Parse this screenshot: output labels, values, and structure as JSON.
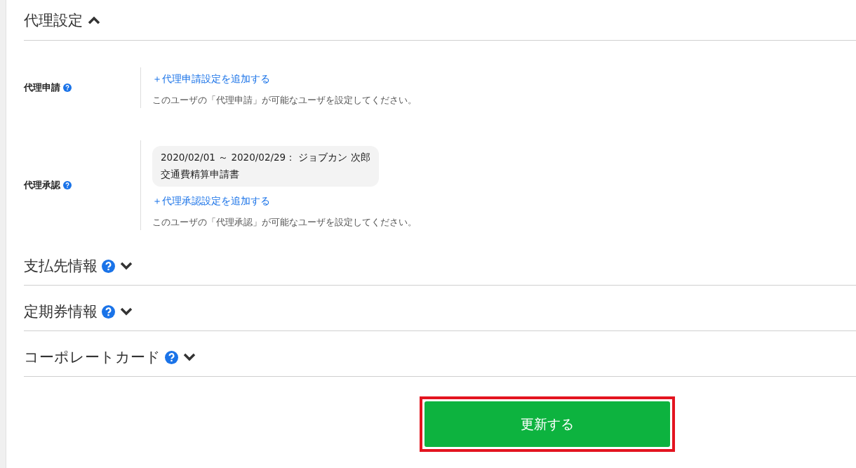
{
  "sections": [
    {
      "title": "代理設定",
      "help": false,
      "expanded": true,
      "rows": [
        {
          "label": "代理申請",
          "help": true,
          "entries": [],
          "add_link": "＋代理申請設定を追加する",
          "note": "このユーザの「代理申請」が可能なユーザを設定してください。"
        },
        {
          "label": "代理承認",
          "help": true,
          "entries": [
            {
              "period": "2020/02/01 ～ 2020/02/29： ジョブカン 次郎",
              "form": "交通費精算申請書"
            }
          ],
          "add_link": "＋代理承認設定を追加する",
          "note": "このユーザの「代理承認」が可能なユーザを設定してください。"
        }
      ]
    },
    {
      "title": "支払先情報",
      "help": true,
      "expanded": false
    },
    {
      "title": "定期券情報",
      "help": true,
      "expanded": false
    },
    {
      "title": "コーポレートカード",
      "help": true,
      "expanded": false
    }
  ],
  "submit": {
    "label": "更新する",
    "highlighted": true
  }
}
